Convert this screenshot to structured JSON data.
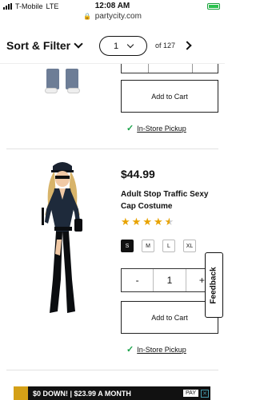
{
  "status_bar": {
    "carrier": "T-Mobile",
    "network": "LTE",
    "time": "12:08 AM",
    "url": "partycity.com"
  },
  "toolbar": {
    "sort_filter_label": "Sort & Filter",
    "current_page": "1",
    "total_pages_label": "of 127"
  },
  "products": [
    {
      "add_to_cart": "Add to Cart",
      "pickup": "In-Store Pickup"
    },
    {
      "price": "$44.99",
      "name": "Adult Stop Traffic Sexy Cap Costume",
      "rating": 4.5,
      "sizes": [
        "S",
        "M",
        "L",
        "XL"
      ],
      "selected_size": "S",
      "quantity": "1",
      "minus": "-",
      "plus": "+",
      "add_to_cart": "Add to Cart",
      "pickup": "In-Store Pickup"
    }
  ],
  "feedback_tab": "Feedback",
  "ad_banner": {
    "text": "$0 DOWN! | $23.99 A MONTH",
    "cta": "PAY"
  },
  "colors": {
    "star": "#e8a300",
    "check": "#1aa34a",
    "battery": "#2bc24e"
  }
}
